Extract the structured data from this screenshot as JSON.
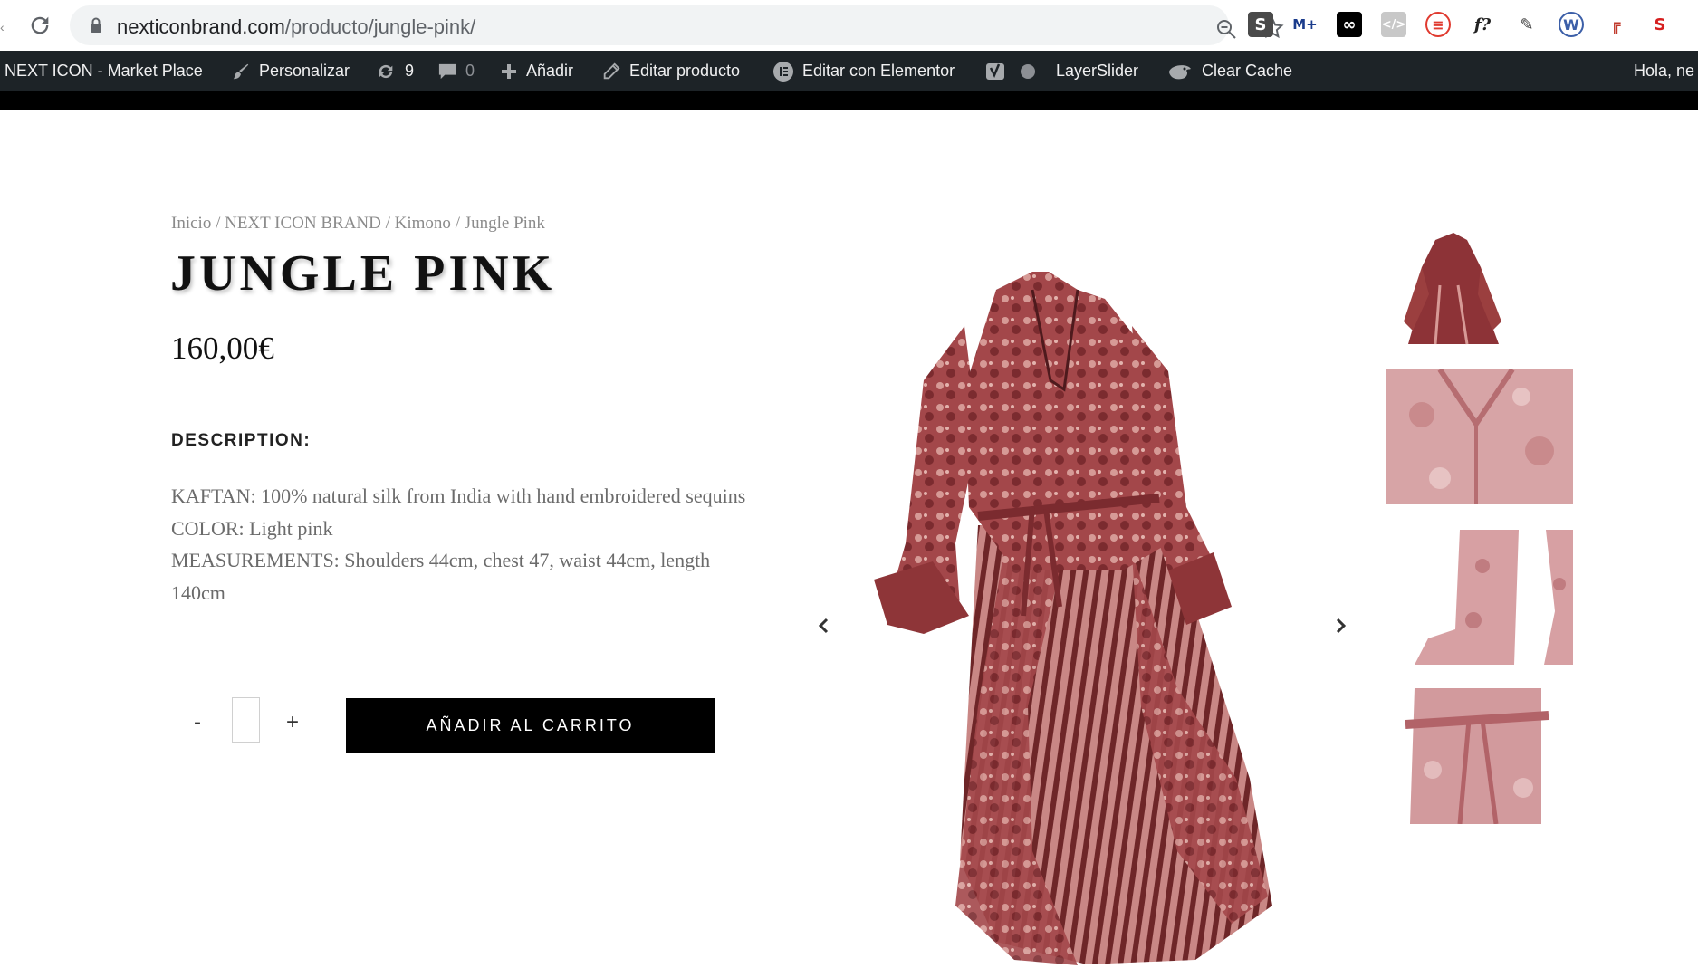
{
  "browser": {
    "url_domain": "nexticonbrand.com",
    "url_path": "/producto/jungle-pink/",
    "extensions": [
      "S",
      "M+",
      "∞",
      "</>",
      "≡",
      "f?",
      "pen",
      "W",
      "╔",
      "S"
    ]
  },
  "adminbar": {
    "site": "NEXT ICON - Market Place",
    "customize": "Personalizar",
    "updates_count": "9",
    "comments_count": "0",
    "add": "Añadir",
    "edit_product": "Editar producto",
    "edit_elementor": "Editar con Elementor",
    "layerslider": "LayerSlider",
    "clear_cache": "Clear Cache",
    "greeting": "Hola, ne"
  },
  "breadcrumb": {
    "home": "Inicio",
    "brand": "NEXT ICON BRAND",
    "category": "Kimono",
    "current": "Jungle Pink",
    "sep": " / "
  },
  "product": {
    "title": "JUNGLE PINK",
    "price": "160,00€",
    "description_heading": "DESCRIPTION:",
    "description_lines": [
      "KAFTAN: 100% natural silk from India with hand embroidered sequins",
      "COLOR: Light pink",
      "MEASUREMENTS: Shoulders 44cm, chest 47, waist 44cm, length 140cm"
    ],
    "qty_minus": "-",
    "qty_plus": "+",
    "quantity": "",
    "add_to_cart": "AÑADIR AL CARRITO"
  },
  "colors": {
    "adminbar_bg": "#1d2327",
    "dress_main": "#9b3f3f",
    "dress_dark": "#5e1e22",
    "dress_light": "#d79a96"
  }
}
